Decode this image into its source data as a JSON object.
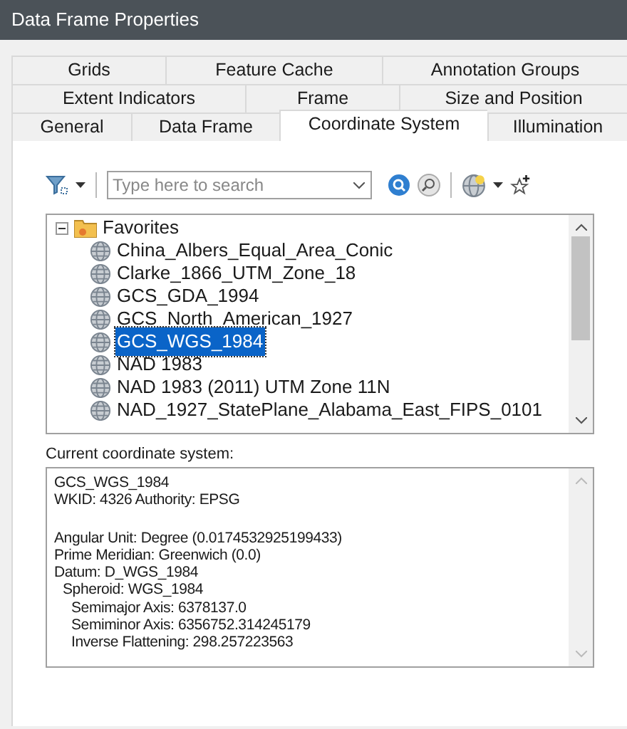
{
  "window": {
    "title": "Data Frame Properties"
  },
  "tab_rows": [
    [
      {
        "label": "Grids",
        "selected": false
      },
      {
        "label": "Feature Cache",
        "selected": false
      },
      {
        "label": "Annotation Groups",
        "selected": false
      }
    ],
    [
      {
        "label": "Extent Indicators",
        "selected": false
      },
      {
        "label": "Frame",
        "selected": false
      },
      {
        "label": "Size and Position",
        "selected": false
      }
    ],
    [
      {
        "label": "General",
        "selected": false
      },
      {
        "label": "Data Frame",
        "selected": false
      },
      {
        "label": "Coordinate System",
        "selected": true
      },
      {
        "label": "Illumination",
        "selected": false
      }
    ]
  ],
  "search": {
    "placeholder": "Type here to search"
  },
  "tree": [
    {
      "label": "Favorites",
      "expanded": true,
      "children": [
        {
          "label": "China_Albers_Equal_Area_Conic",
          "selected": false
        },
        {
          "label": "Clarke_1866_UTM_Zone_18",
          "selected": false
        },
        {
          "label": "GCS_GDA_1994",
          "selected": false
        },
        {
          "label": "GCS_North_American_1927",
          "selected": false
        },
        {
          "label": "GCS_WGS_1984",
          "selected": true
        },
        {
          "label": "NAD 1983",
          "selected": false
        },
        {
          "label": "NAD 1983 (2011) UTM Zone 11N",
          "selected": false
        },
        {
          "label": "NAD_1927_StatePlane_Alabama_East_FIPS_0101",
          "selected": false
        }
      ]
    }
  ],
  "current_label": "Current coordinate system:",
  "details": [
    {
      "text": "GCS_WGS_1984"
    },
    {
      "text": "WKID: 4326 Authority: EPSG"
    },
    {
      "kind": "blank"
    },
    {
      "text": "Angular Unit: Degree (0.0174532925199433)"
    },
    {
      "text": "Prime Meridian: Greenwich (0.0)"
    },
    {
      "text": "Datum: D_WGS_1984",
      "children": [
        {
          "text": "Spheroid: WGS_1984",
          "children": [
            {
              "text": "Semimajor Axis: 6378137.0"
            },
            {
              "text": "Semiminor Axis: 6356752.314245179"
            },
            {
              "text": "Inverse Flattening: 298.257223563"
            }
          ]
        }
      ]
    }
  ]
}
